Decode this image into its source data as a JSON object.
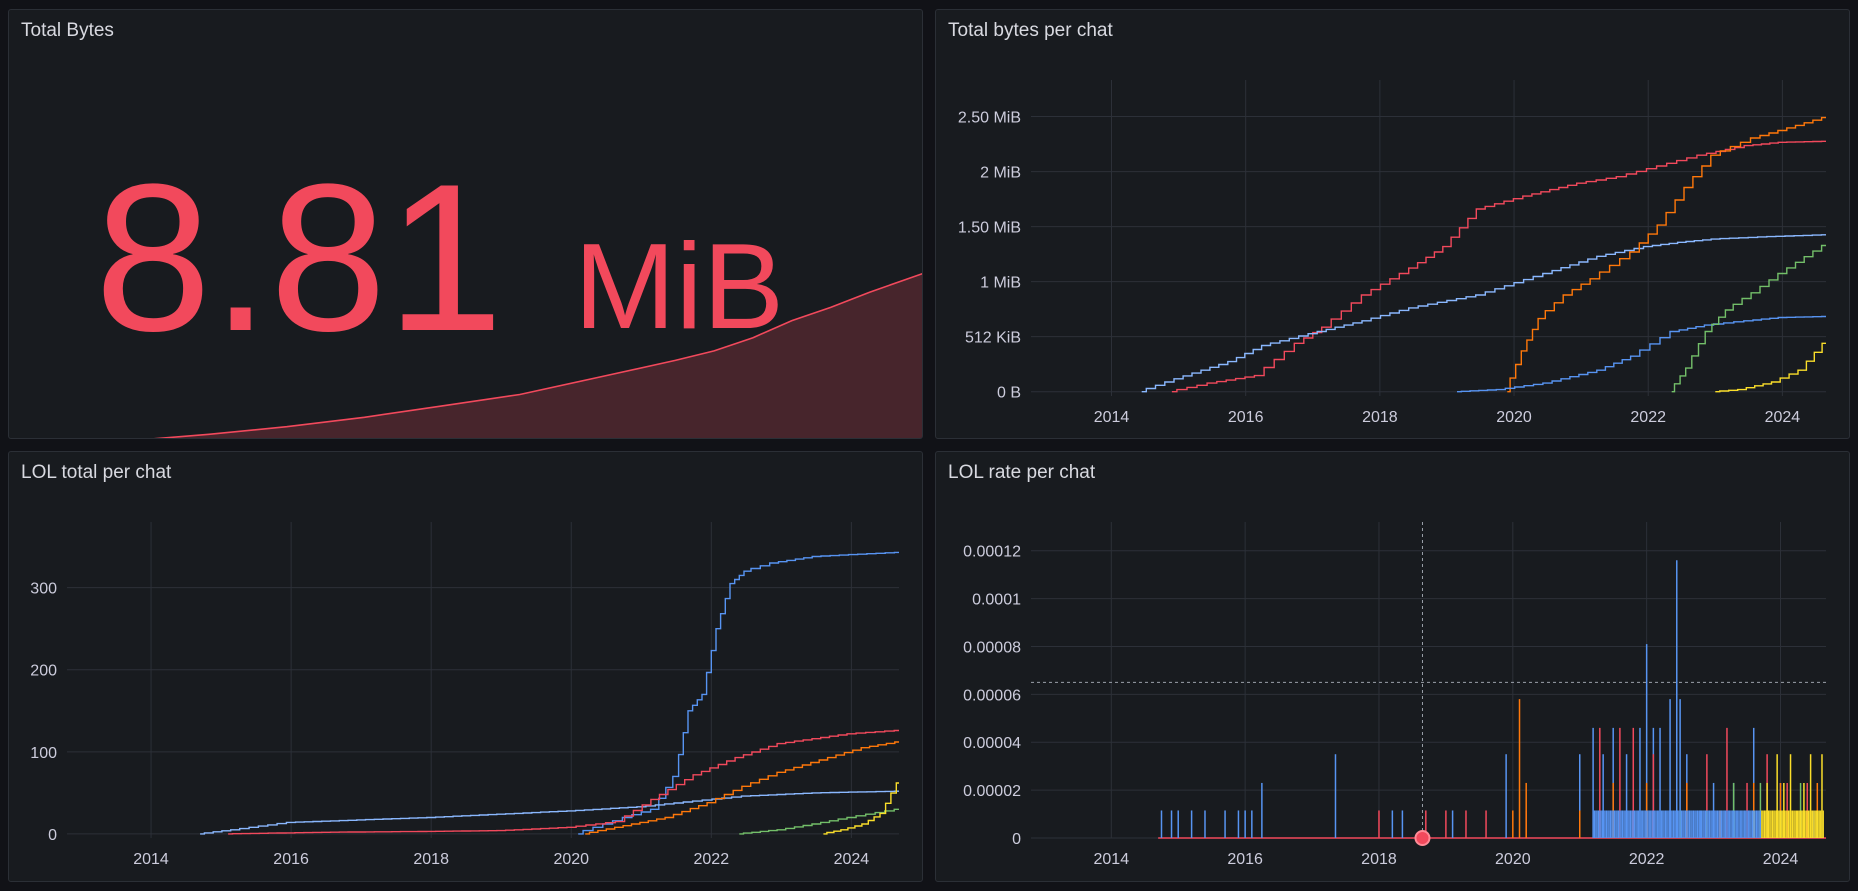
{
  "colors": {
    "red": "#f2495c",
    "orange": "#ff780a",
    "blue": "#5794f2",
    "lightblue": "#8ab8ff",
    "green": "#73bf69",
    "yellow": "#fade2a",
    "grid": "#2c3038"
  },
  "panels": {
    "total_bytes": {
      "title": "Total Bytes",
      "value": "8.81",
      "unit": "MiB"
    },
    "bytes_per_chat": {
      "title": "Total bytes per chat"
    },
    "lol_total": {
      "title": "LOL total per chat"
    },
    "lol_rate": {
      "title": "LOL rate per chat"
    }
  },
  "chart_data": [
    {
      "type": "area",
      "title": "Total Bytes",
      "x_range": [
        2014.6,
        2024.7
      ],
      "ylim": [
        0,
        9.5
      ],
      "series": [
        {
          "color": "#f2495c",
          "x": [
            2014.6,
            2015.5,
            2016.5,
            2017.5,
            2018.5,
            2019.5,
            2020.5,
            2021.5,
            2022.0,
            2022.5,
            2023.0,
            2023.5,
            2024.0,
            2024.7
          ],
          "y": [
            0.0,
            0.3,
            0.7,
            1.2,
            1.8,
            2.4,
            3.3,
            4.2,
            4.7,
            5.4,
            6.3,
            7.0,
            7.8,
            8.81
          ]
        }
      ]
    },
    {
      "type": "line",
      "title": "Total bytes per chat",
      "xlim": [
        2012.8,
        2024.65
      ],
      "ylim": [
        -40,
        2900
      ],
      "x_ticks": [
        2014,
        2016,
        2018,
        2020,
        2022,
        2024
      ],
      "y_ticks": [
        {
          "v": 0,
          "label": "0 B"
        },
        {
          "v": 512,
          "label": "512 KiB"
        },
        {
          "v": 1024,
          "label": "1 MiB"
        },
        {
          "v": 1536,
          "label": "1.50 MiB"
        },
        {
          "v": 2048,
          "label": "2 MiB"
        },
        {
          "v": 2560,
          "label": "2.50 MiB"
        }
      ],
      "series": [
        {
          "color": "#f2495c",
          "x": [
            2014.9,
            2015.5,
            2016.2,
            2016.8,
            2017.2,
            2017.8,
            2018.5,
            2019.0,
            2019.5,
            2020.2,
            2021.0,
            2021.6,
            2022.2,
            2022.8,
            2023.5,
            2024.0,
            2024.65
          ],
          "y": [
            0,
            80,
            150,
            450,
            600,
            900,
            1150,
            1350,
            1700,
            1820,
            1940,
            2000,
            2100,
            2200,
            2290,
            2320,
            2330
          ]
        },
        {
          "color": "#8ab8ff",
          "x": [
            2014.45,
            2015.0,
            2015.8,
            2016.3,
            2017.0,
            2017.8,
            2018.5,
            2019.5,
            2020.5,
            2021.3,
            2022.0,
            2022.5,
            2023.0,
            2023.7,
            2024.65
          ],
          "y": [
            0,
            120,
            280,
            430,
            540,
            660,
            780,
            900,
            1100,
            1260,
            1350,
            1390,
            1420,
            1440,
            1460
          ]
        },
        {
          "color": "#ff780a",
          "x": [
            2019.9,
            2020.15,
            2020.4,
            2020.8,
            2021.2,
            2021.8,
            2022.2,
            2022.6,
            2023.0,
            2023.6,
            2024.0,
            2024.65
          ],
          "y": [
            0,
            380,
            680,
            900,
            1050,
            1300,
            1550,
            1900,
            2200,
            2360,
            2430,
            2550
          ]
        },
        {
          "color": "#5794f2",
          "x": [
            2019.15,
            2019.8,
            2020.5,
            2021.3,
            2021.8,
            2022.4,
            2022.9,
            2023.5,
            2024.0,
            2024.65
          ],
          "y": [
            0,
            20,
            80,
            200,
            330,
            560,
            620,
            660,
            690,
            700
          ]
        },
        {
          "color": "#73bf69",
          "x": [
            2022.35,
            2022.6,
            2022.9,
            2023.2,
            2023.6,
            2024.0,
            2024.65
          ],
          "y": [
            0,
            220,
            560,
            760,
            920,
            1100,
            1360
          ]
        },
        {
          "color": "#fade2a",
          "x": [
            2023.0,
            2023.4,
            2023.9,
            2024.3,
            2024.65
          ],
          "y": [
            0,
            20,
            90,
            200,
            450
          ]
        }
      ]
    },
    {
      "type": "line",
      "title": "LOL total per chat",
      "xlim": [
        2012.8,
        2024.68
      ],
      "ylim": [
        -5,
        380
      ],
      "x_ticks": [
        2014,
        2016,
        2018,
        2020,
        2022,
        2024
      ],
      "y_ticks": [
        {
          "v": 0,
          "label": "0"
        },
        {
          "v": 100,
          "label": "100"
        },
        {
          "v": 200,
          "label": "200"
        },
        {
          "v": 300,
          "label": "300"
        }
      ],
      "series": [
        {
          "color": "#5794f2",
          "x": [
            2020.1,
            2020.8,
            2021.2,
            2021.5,
            2021.7,
            2021.9,
            2022.1,
            2022.3,
            2022.5,
            2022.9,
            2023.5,
            2024.68
          ],
          "y": [
            0,
            20,
            30,
            70,
            150,
            170,
            250,
            305,
            320,
            330,
            338,
            343
          ]
        },
        {
          "color": "#8ab8ff",
          "x": [
            2014.7,
            2015.2,
            2016.0,
            2017.0,
            2018.0,
            2019.0,
            2020.0,
            2021.0,
            2021.8,
            2022.5,
            2023.5,
            2024.68
          ],
          "y": [
            0,
            5,
            14,
            17,
            20,
            24,
            28,
            33,
            40,
            46,
            50,
            52
          ]
        },
        {
          "color": "#f2495c",
          "x": [
            2015.1,
            2016.5,
            2018.0,
            2019.0,
            2020.0,
            2020.7,
            2021.2,
            2021.8,
            2022.4,
            2023.0,
            2024.0,
            2024.68
          ],
          "y": [
            0,
            2,
            3,
            4,
            8,
            15,
            42,
            72,
            93,
            110,
            122,
            126
          ]
        },
        {
          "color": "#ff780a",
          "x": [
            2020.2,
            2020.8,
            2021.4,
            2022.0,
            2022.5,
            2023.0,
            2023.6,
            2024.2,
            2024.68
          ],
          "y": [
            0,
            10,
            20,
            38,
            58,
            75,
            90,
            105,
            112
          ]
        },
        {
          "color": "#73bf69",
          "x": [
            2022.4,
            2023.0,
            2023.5,
            2024.0,
            2024.68
          ],
          "y": [
            0,
            5,
            12,
            20,
            30
          ]
        },
        {
          "color": "#fade2a",
          "x": [
            2023.6,
            2023.9,
            2024.2,
            2024.45,
            2024.68
          ],
          "y": [
            0,
            5,
            12,
            25,
            62
          ]
        }
      ]
    },
    {
      "type": "bar",
      "title": "LOL rate per chat",
      "xlim": [
        2012.8,
        2024.68
      ],
      "ylim": [
        0,
        0.000132
      ],
      "x_ticks": [
        2014,
        2016,
        2018,
        2020,
        2022,
        2024
      ],
      "y_ticks": [
        {
          "v": 0,
          "label": "0"
        },
        {
          "v": 2e-05,
          "label": "0.00002"
        },
        {
          "v": 4e-05,
          "label": "0.00004"
        },
        {
          "v": 6e-05,
          "label": "0.00006"
        },
        {
          "v": 8e-05,
          "label": "0.00008"
        },
        {
          "v": 0.0001,
          "label": "0.0001"
        },
        {
          "v": 0.00012,
          "label": "0.00012"
        }
      ],
      "crosshair": {
        "x": 2018.65,
        "y": 6.5e-05
      },
      "series": [
        {
          "color": "#5794f2",
          "x": [
            2014.75,
            2014.9,
            2015.0,
            2015.2,
            2015.4,
            2015.7,
            2015.9,
            2016.0,
            2016.1,
            2016.25,
            2017.35,
            2018.2,
            2018.35,
            2019.1,
            2019.9,
            2021.0,
            2021.2,
            2021.35,
            2021.5,
            2021.7,
            2021.9,
            2022.0,
            2022.1,
            2022.2,
            2022.35,
            2022.45,
            2022.5,
            2022.6,
            2022.8,
            2023.0,
            2023.3,
            2023.6,
            2023.8,
            2024.0,
            2024.3,
            2024.5
          ],
          "y": [
            1.15e-05,
            1.15e-05,
            1.15e-05,
            1.15e-05,
            1.15e-05,
            1.15e-05,
            1.15e-05,
            1.15e-05,
            1.15e-05,
            2.3e-05,
            3.5e-05,
            1.15e-05,
            1.15e-05,
            1.15e-05,
            3.5e-05,
            3.5e-05,
            4.6e-05,
            3.5e-05,
            4.6e-05,
            3.5e-05,
            4.6e-05,
            8.1e-05,
            4.6e-05,
            4.6e-05,
            5.8e-05,
            0.000116,
            5.8e-05,
            3.5e-05,
            1.15e-05,
            2.3e-05,
            2.3e-05,
            4.6e-05,
            1.15e-05,
            2.3e-05,
            1.15e-05,
            1.15e-05
          ]
        },
        {
          "color": "#f2495c",
          "x": [
            2018.0,
            2018.7,
            2019.0,
            2019.3,
            2019.6,
            2020.2,
            2021.3,
            2021.6,
            2021.8,
            2022.1,
            2022.6,
            2022.9,
            2023.2,
            2023.5,
            2023.8,
            2024.1,
            2024.4
          ],
          "y": [
            1.15e-05,
            1.15e-05,
            1.15e-05,
            1.15e-05,
            1.15e-05,
            1.15e-05,
            4.6e-05,
            4.6e-05,
            4.6e-05,
            3.5e-05,
            2.3e-05,
            3.5e-05,
            4.6e-05,
            2.3e-05,
            3.5e-05,
            2.3e-05,
            2.3e-05
          ]
        },
        {
          "color": "#ff780a",
          "x": [
            2020.0,
            2020.1,
            2020.2,
            2021.0,
            2021.5,
            2022.0,
            2022.6,
            2023.1,
            2023.6,
            2024.0,
            2024.3,
            2024.55
          ],
          "y": [
            1.15e-05,
            5.8e-05,
            2.3e-05,
            1.15e-05,
            2.3e-05,
            2.3e-05,
            2.3e-05,
            1.15e-05,
            2.3e-05,
            2.3e-05,
            1.15e-05,
            2.3e-05
          ]
        },
        {
          "color": "#73bf69",
          "x": [
            2022.5,
            2022.9,
            2023.3,
            2023.7,
            2024.0,
            2024.3
          ],
          "y": [
            1.15e-05,
            1.15e-05,
            2.3e-05,
            2.3e-05,
            1.15e-05,
            2.3e-05
          ]
        },
        {
          "color": "#fade2a",
          "x": [
            2023.6,
            2023.8,
            2023.95,
            2024.05,
            2024.15,
            2024.25,
            2024.35,
            2024.45,
            2024.55,
            2024.62
          ],
          "y": [
            1.15e-05,
            2.3e-05,
            3.5e-05,
            2.3e-05,
            3.5e-05,
            1.15e-05,
            2.3e-05,
            3.5e-05,
            1.15e-05,
            3.5e-05
          ]
        }
      ]
    }
  ]
}
